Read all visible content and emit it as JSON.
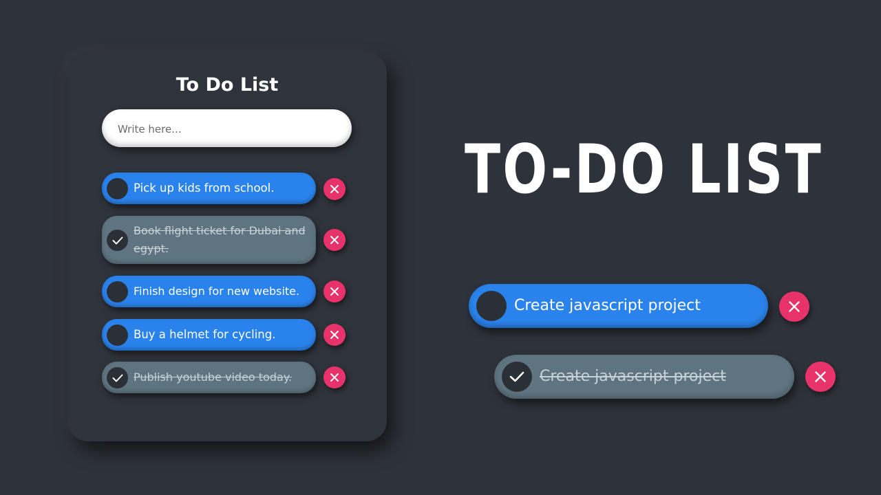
{
  "card": {
    "title": "To Do List",
    "input": {
      "placeholder": "Write here...",
      "value": ""
    }
  },
  "tasks": [
    {
      "label": "Pick up kids from school.",
      "done": false
    },
    {
      "label": "Book flight ticket for Dubai and egypt.",
      "done": true
    },
    {
      "label": "Finish design for new website.",
      "done": false
    },
    {
      "label": "Buy a helmet for cycling.",
      "done": false
    },
    {
      "label": "Publish youtube video today.",
      "done": true
    }
  ],
  "hero": {
    "title": "TO-DO LIST"
  },
  "demo": [
    {
      "label": "Create javascript project",
      "done": false
    },
    {
      "label": "Create javascript project",
      "done": true
    }
  ],
  "colors": {
    "background": "#2e323a",
    "active_task": "#2a83ec",
    "done_task": "#5e7480",
    "delete_button": "#e8336a"
  },
  "icons": {
    "check": "check-icon",
    "delete": "close-icon"
  }
}
